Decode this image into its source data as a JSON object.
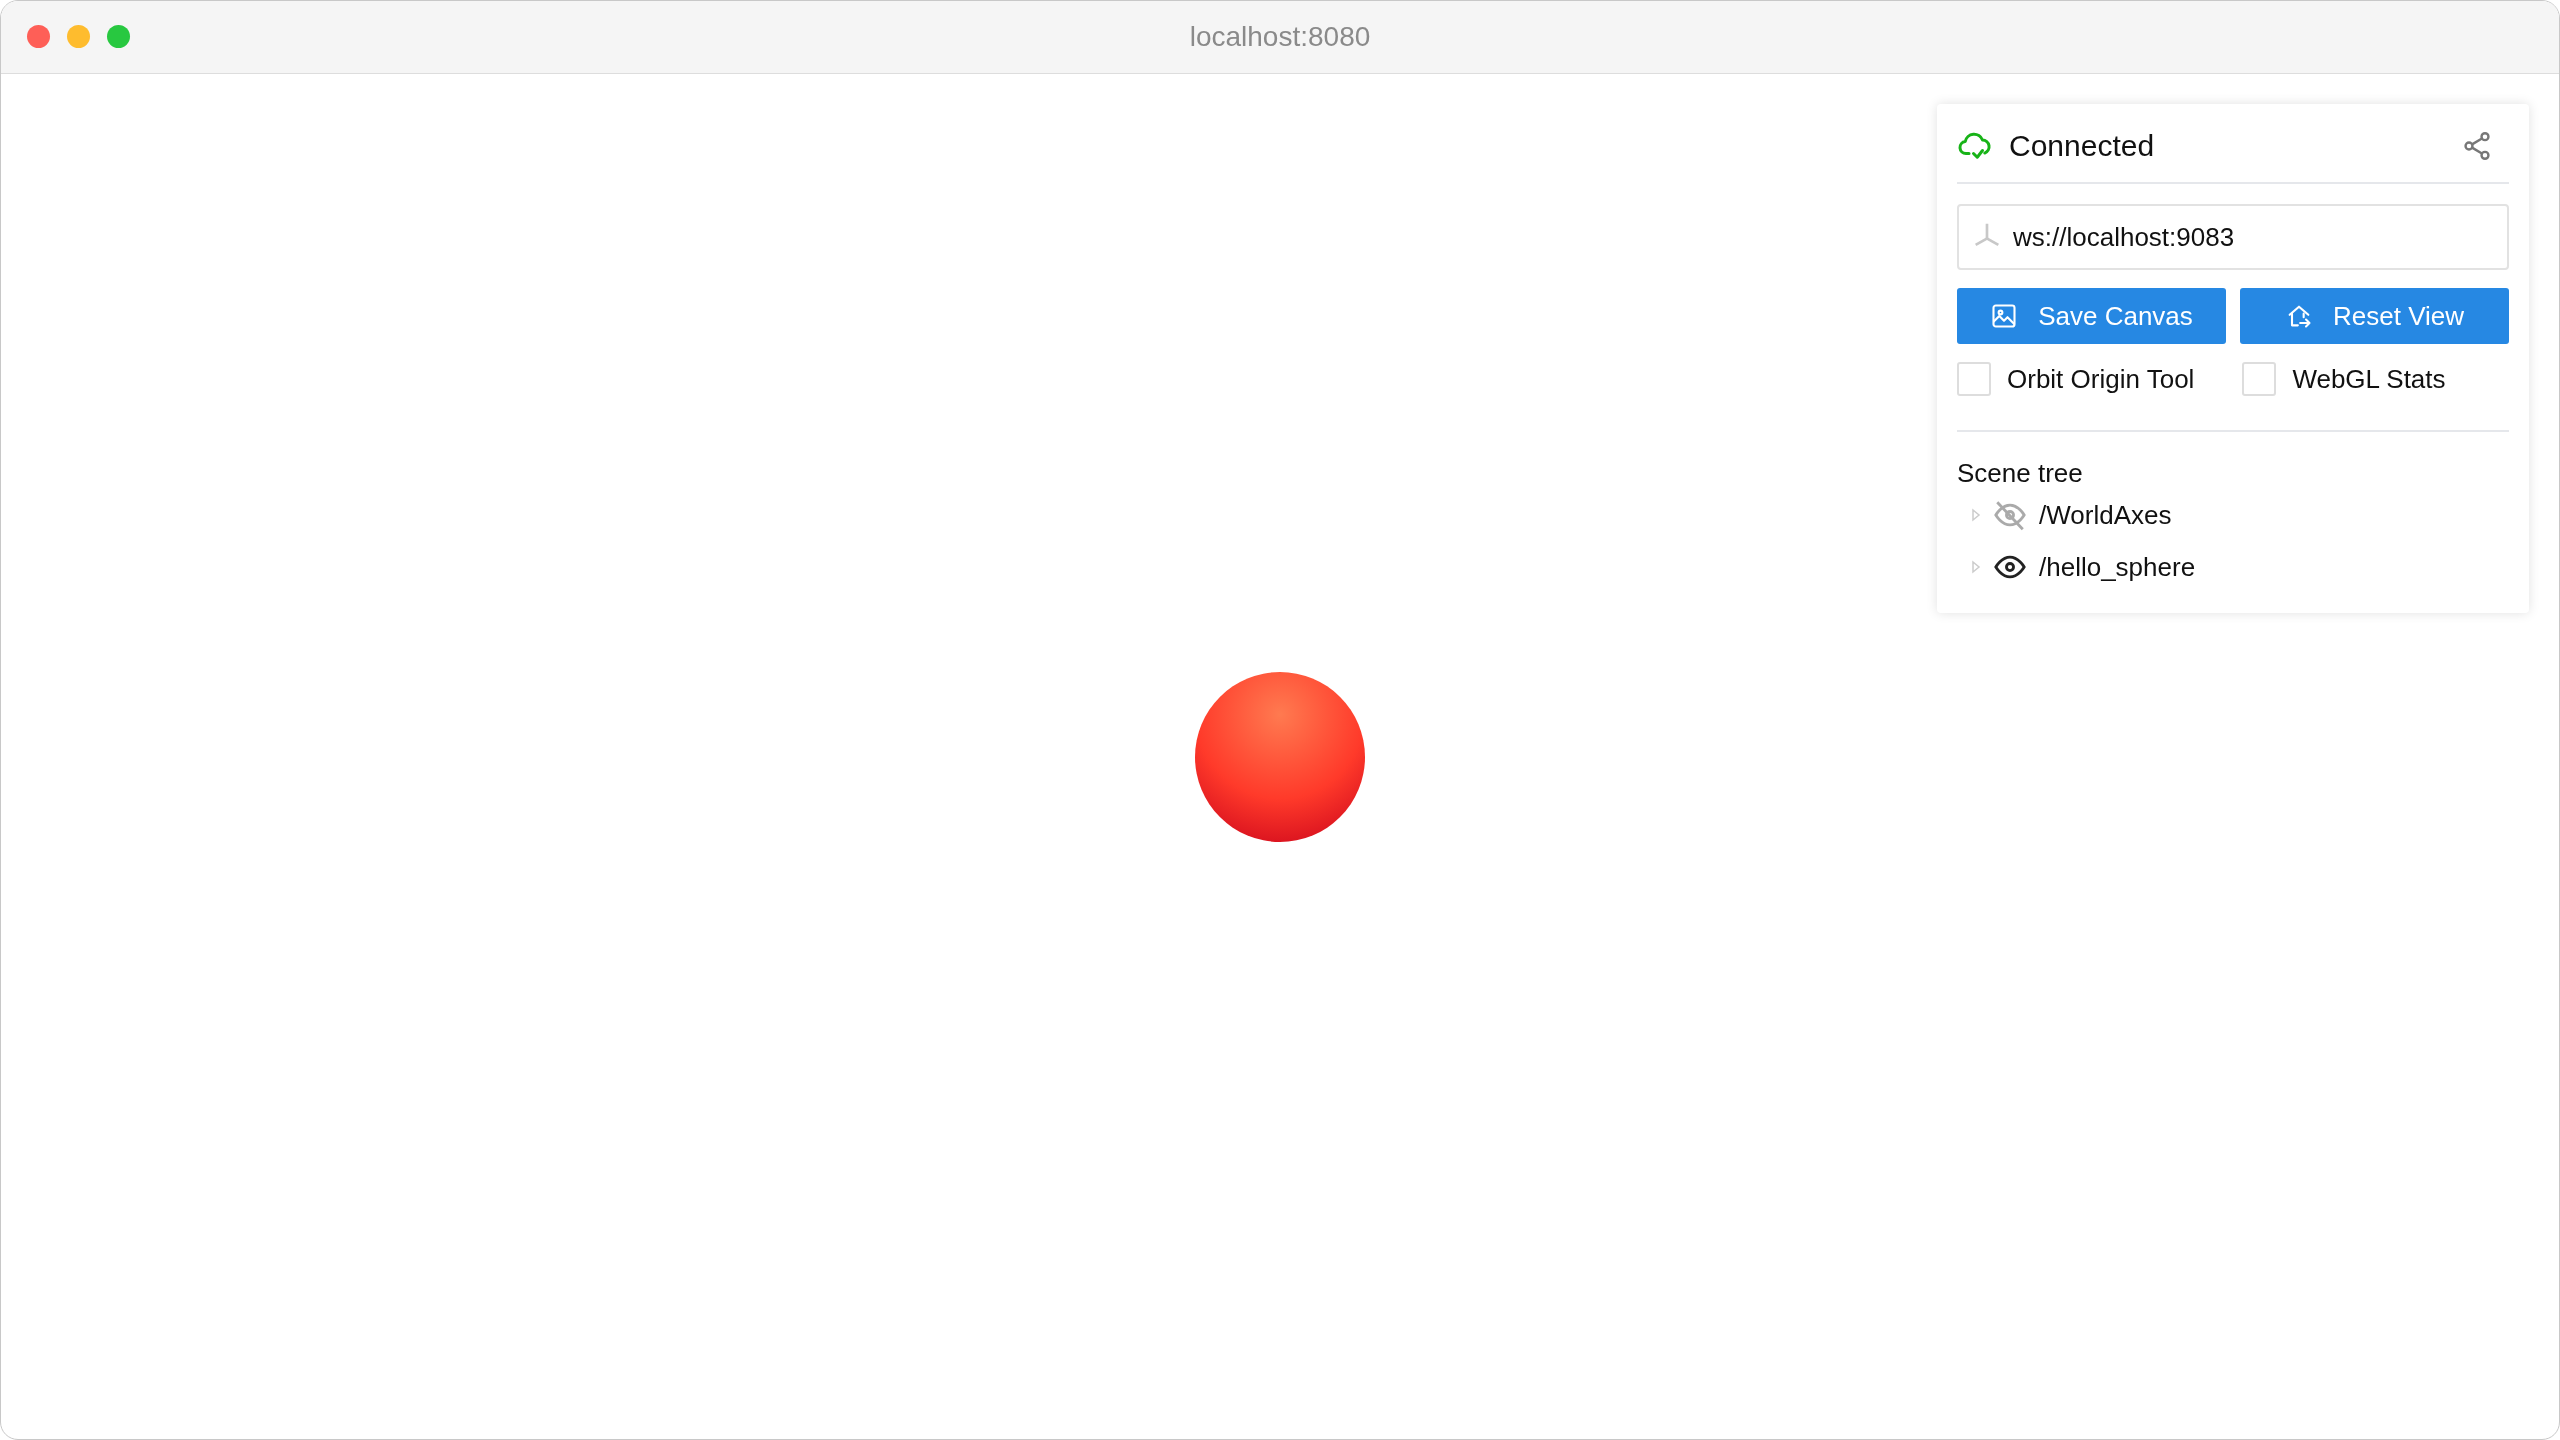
{
  "window": {
    "title": "localhost:8080"
  },
  "panel": {
    "status": "Connected",
    "server_field": {
      "value": "ws://localhost:9083"
    },
    "buttons": [
      {
        "label": "Save Canvas",
        "kind": "image"
      },
      {
        "label": "Reset View",
        "kind": "home"
      }
    ],
    "checkboxes": [
      {
        "label": "Orbit Origin Tool",
        "checked": false
      },
      {
        "label": "WebGL Stats",
        "checked": false
      }
    ],
    "scene_tree": {
      "title": "Scene tree",
      "items": [
        {
          "name": "/WorldAxes",
          "visible": false,
          "expanded": false
        },
        {
          "name": "/hello_sphere",
          "visible": true,
          "expanded": false
        }
      ]
    }
  }
}
